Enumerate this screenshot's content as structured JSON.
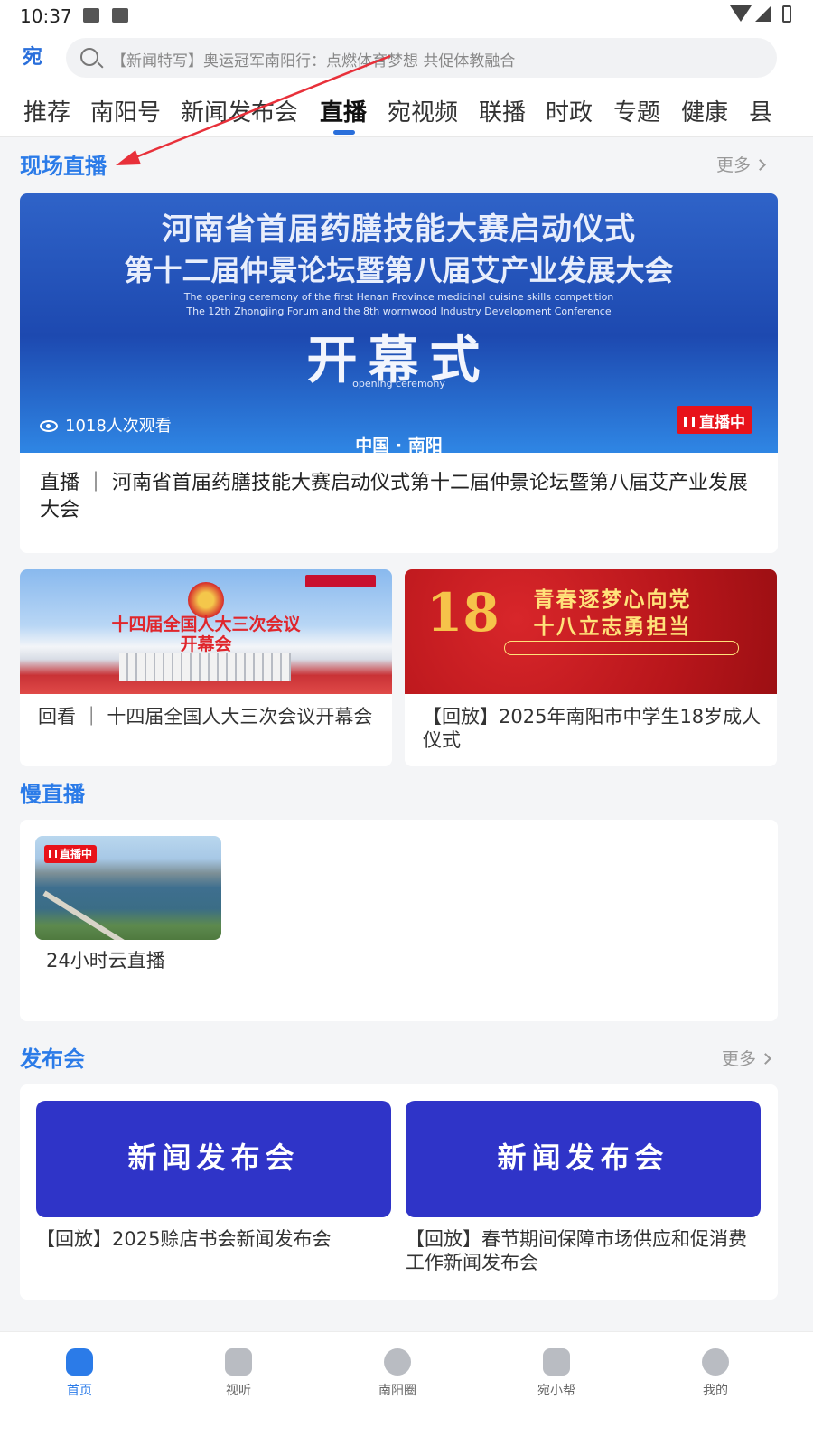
{
  "status_bar": {
    "time": "10:37"
  },
  "header": {
    "logo_text": "宛",
    "search_placeholder": "【新闻特写】奥运冠军南阳行：点燃体育梦想  共促体教融合",
    "tabs": [
      {
        "label": "推荐"
      },
      {
        "label": "南阳号"
      },
      {
        "label": "新闻发布会"
      },
      {
        "label": "直播",
        "active": true
      },
      {
        "label": "宛视频"
      },
      {
        "label": "联播"
      },
      {
        "label": "时政"
      },
      {
        "label": "专题"
      },
      {
        "label": "健康"
      },
      {
        "label": "县"
      }
    ]
  },
  "live_section": {
    "title": "现场直播",
    "more_label": "更多",
    "hero": {
      "image_title_line1": "河南省首届药膳技能大赛启动仪式",
      "image_title_line2": "第十二届仲景论坛暨第八届艾产业发展大会",
      "image_en_line1": "The opening ceremony of the first Henan Province medicinal cuisine skills competition",
      "image_en_line2": "The 12th Zhongjing Forum and the 8th wormwood Industry Development Conference",
      "image_big_text": "开幕式",
      "image_en_line3": "opening ceremony",
      "image_place": "中国 · 南阳",
      "views": "1018人次观看",
      "badge": "直播中",
      "title": "直播 ｜ 河南省首届药膳技能大赛启动仪式第十二届仲景论坛暨第八届艾产业发展大会"
    },
    "cards": [
      {
        "image_line1": "十四届全国人大三次会议",
        "image_line2": "开幕会",
        "title": "回看 ｜ 十四届全国人大三次会议开幕会"
      },
      {
        "image_line1": "青春逐梦心向党",
        "image_line2": "十八立志勇担当",
        "title": "【回放】2025年南阳市中学生18岁成人仪式"
      }
    ]
  },
  "slow_section": {
    "title": "慢直播",
    "item": {
      "badge": "直播中",
      "title": "24小时云直播"
    }
  },
  "press_section": {
    "title": "发布会",
    "more_label": "更多",
    "cards": [
      {
        "image_text": "新闻发布会",
        "title": "【回放】2025赊店书会新闻发布会"
      },
      {
        "image_text": "新闻发布会",
        "title": "【回放】春节期间保障市场供应和促消费工作新闻发布会"
      }
    ]
  },
  "bottom_nav": [
    {
      "label": "首页",
      "icon": "home-icon",
      "active": true
    },
    {
      "label": "视听",
      "icon": "video-icon"
    },
    {
      "label": "南阳圈",
      "icon": "compass-icon"
    },
    {
      "label": "宛小帮",
      "icon": "help-icon"
    },
    {
      "label": "我的",
      "icon": "profile-icon"
    }
  ],
  "colors": {
    "accent": "#2b7be8",
    "live_red": "#e8121a",
    "press_blue": "#2f34c8"
  }
}
